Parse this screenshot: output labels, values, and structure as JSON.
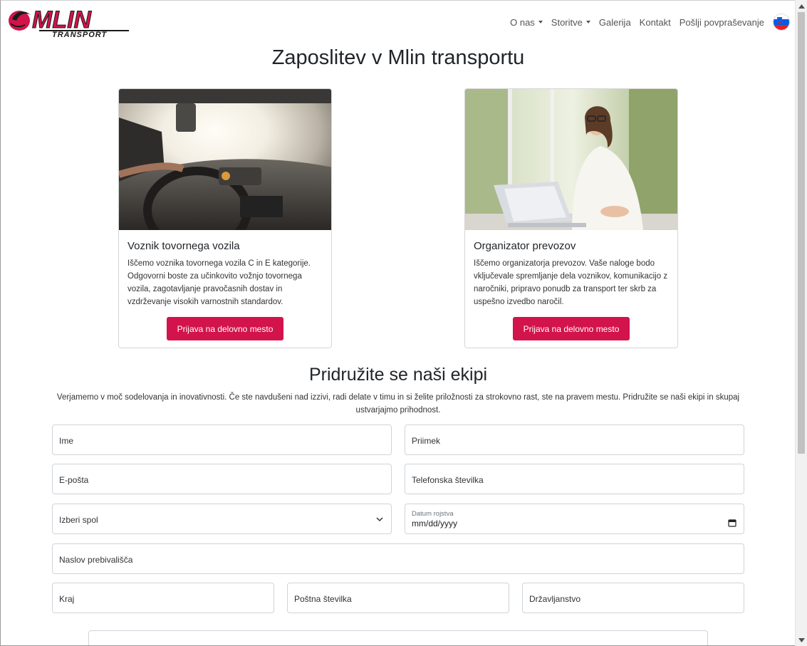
{
  "brand": {
    "name": "MLIN",
    "subname": "TRANSPORT",
    "color": "#d3134b"
  },
  "nav": {
    "items": [
      {
        "label": "O nas",
        "dropdown": true
      },
      {
        "label": "Storitve",
        "dropdown": true
      },
      {
        "label": "Galerija",
        "dropdown": false
      },
      {
        "label": "Kontakt",
        "dropdown": false
      },
      {
        "label": "Pošlji povpraševanje",
        "dropdown": false
      }
    ],
    "language_flag": "slovenia-flag-icon"
  },
  "page_title": "Zaposlitev v Mlin transportu",
  "jobs": [
    {
      "title": "Voznik tovornega vozila",
      "description": "Iščemo voznika tovornega vozila C in E kategorije. Odgovorni boste za učinkovito vožnjo tovornega vozila, zagotavljanje pravočasnih dostav in vzdrževanje visokih varnostnih standardov.",
      "button": "Prijava na delovno mesto",
      "image": "truck-driver-photo"
    },
    {
      "title": "Organizator prevozov",
      "description": "Iščemo organizatorja prevozov. Vaše naloge bodo vključevale spremljanje dela voznikov, komunikacijo z naročniki, pripravo ponudb za transport ter skrb za uspešno izvedbo naročil.",
      "button": "Prijava na delovno mesto",
      "image": "office-woman-laptop-photo"
    }
  ],
  "team": {
    "title": "Pridružite se naši ekipi",
    "intro": "Verjamemo v moč sodelovanja in inovativnosti. Če ste navdušeni nad izzivi, radi delate v timu in si želite priložnosti za strokovno rast, ste na pravem mestu. Pridružite se naši ekipi in skupaj ustvarjajmo prihodnost."
  },
  "form": {
    "first_name": "Ime",
    "last_name": "Priimek",
    "email": "E-pošta",
    "phone": "Telefonska številka",
    "gender": "Izberi spol",
    "birthdate_label": "Datum rojstva",
    "birthdate_value": "mm/dd/yyyy",
    "address": "Naslov prebivališča",
    "city": "Kraj",
    "postal": "Poštna številka",
    "citizenship": "Državljanstvo"
  }
}
